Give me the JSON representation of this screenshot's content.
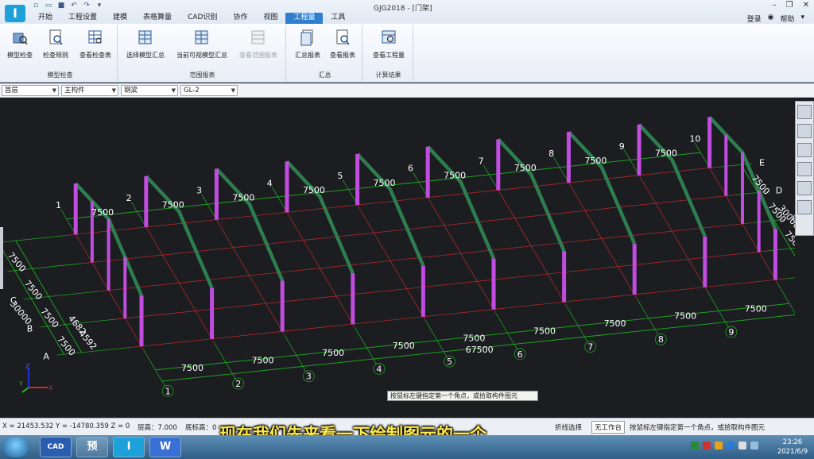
{
  "title_bar": {
    "window_title": "GJG2018 - [门架]",
    "login": "登录",
    "help": "帮助",
    "tabs": [
      "开始",
      "工程设置",
      "建模",
      "表格算量",
      "CAD识别",
      "协作",
      "视图",
      "工程量",
      "工具"
    ],
    "active_tab": "工程量"
  },
  "ribbon": {
    "groups": [
      {
        "label": "模型检查",
        "buttons": [
          "模型检查",
          "检查规则",
          "查看检查表"
        ]
      },
      {
        "label": "范围报表",
        "buttons": [
          "选择模型汇总",
          "当前可视模型汇总",
          "查看范围报表"
        ]
      },
      {
        "label": "汇总",
        "buttons": [
          "汇总报表",
          "查看报表"
        ]
      },
      {
        "label": "计算结果",
        "buttons": [
          "查看工程量"
        ]
      }
    ]
  },
  "selectors": {
    "floor": "首层",
    "category": "主构件",
    "type": "钢梁",
    "member": "GL-2"
  },
  "viewport": {
    "axis_numbers": [
      "1",
      "2",
      "3",
      "4",
      "5",
      "6",
      "7",
      "8",
      "9",
      "10"
    ],
    "axis_letters": [
      "A",
      "B",
      "C",
      "D",
      "E"
    ],
    "dimensions": {
      "bay": "7500",
      "total_length": "67500",
      "total_width": "30000",
      "edge_a": "4592",
      "edge_b": "4682"
    },
    "tooltip": "按鼠标左键指定第一个角点，或拾取构件图元",
    "triad": {
      "x": "X",
      "y": "Y",
      "z": "Z"
    }
  },
  "status_bar": {
    "coords": "X = 21453.532 Y = -14780.359 Z = 0",
    "floor_height": "层高：7.000",
    "base_elevation": "底标高：0",
    "mode": "折线选择",
    "work_plane": "无工作台",
    "hint": "按鼠标左键指定第一个角点，或拾取构件图元"
  },
  "subtitle": "现在我们先来看一下绘制图元的一个",
  "taskbar": {
    "apps": [
      "CAD",
      "预",
      "I",
      "W"
    ],
    "time": "23:26",
    "date": "2021/6/9"
  },
  "colors": {
    "accent": "#2f7fd1",
    "rafter": "#2e7d4f",
    "column": "#c04de0",
    "grid_green": "#1fa11f",
    "grid_red": "#b02a2a",
    "subtitle": "#ffe94a"
  }
}
